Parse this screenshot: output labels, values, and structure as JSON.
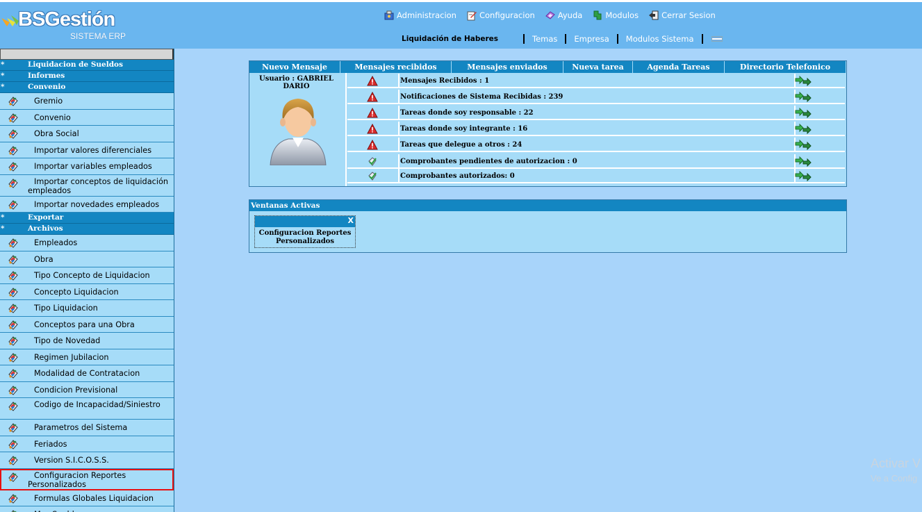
{
  "app": {
    "brand": "BSGestión",
    "subtitle": "SISTEMA ERP"
  },
  "topnav": [
    {
      "label": "Administracion",
      "icon": "admin-icon"
    },
    {
      "label": "Configuracion",
      "icon": "config-icon"
    },
    {
      "label": "Ayuda",
      "icon": "help-icon"
    },
    {
      "label": "Modulos",
      "icon": "modules-icon"
    },
    {
      "label": "Cerrar Sesion",
      "icon": "logout-icon"
    }
  ],
  "subnav": {
    "current": "Liquidación de Haberes",
    "links": [
      "Temas",
      "Empresa",
      "Modulos Sistema"
    ]
  },
  "sidebar": {
    "sections": [
      {
        "label": "Liquidacion de Sueldos",
        "items": []
      },
      {
        "label": "Informes",
        "items": []
      },
      {
        "label": "Convenio",
        "items": [
          "Gremio",
          "Convenio",
          "Obra Social",
          "Importar valores diferenciales",
          "Importar variables empleados",
          "Importar conceptos de liquidación empleados",
          "Importar novedades empleados"
        ]
      },
      {
        "label": "Exportar",
        "items": []
      },
      {
        "label": "Archivos",
        "items": [
          "Empleados",
          "Obra",
          "Tipo Concepto de Liquidacion",
          "Concepto Liquidacion",
          "Tipo Liquidacion",
          "Conceptos para una Obra",
          "Tipo de Novedad",
          "Regimen Jubilacion",
          "Modalidad de Contratacion",
          "Condicion Previsional",
          "Codigo de Incapacidad/Siniestro",
          "Parametros del Sistema",
          "Feriados",
          "Version S.I.C.O.S.S.",
          "Configuracion Reportes Personalizados",
          "Formulas Globales Liquidacion",
          "Mes Sueldo"
        ]
      }
    ],
    "highlighted": "Configuracion Reportes Personalizados"
  },
  "messages": {
    "tabs": [
      "Nuevo Mensaje",
      "Mensajes recibidos",
      "Mensajes enviados",
      "Nueva tarea",
      "Agenda Tareas",
      "Directorio Telefonico"
    ],
    "user_label": "Usuario : GABRIEL DARIO",
    "rows": [
      {
        "text": "Mensajes Recibidos : 1",
        "status": "warning"
      },
      {
        "text": "Notificaciones de Sistema Recibidas : 239",
        "status": "warning"
      },
      {
        "text": "Tareas donde soy responsable : 22",
        "status": "warning"
      },
      {
        "text": "Tareas donde soy integrante : 16",
        "status": "warning"
      },
      {
        "text": "Tareas que delegue a otros : 24",
        "status": "warning"
      },
      {
        "text": "Comprobantes pendientes de autorizacion : 0",
        "status": "ok"
      },
      {
        "text": "Comprobantes autorizados: 0",
        "status": "ok"
      }
    ]
  },
  "active_windows": {
    "title": "Ventanas Activas",
    "close_label": "X",
    "windows": [
      "Configuracion Reportes Personalizados"
    ]
  },
  "watermark": {
    "line1": "Activar V",
    "line2": "Ve a Config"
  },
  "colors": {
    "header": "#6ab6ef",
    "background": "#a8d4fa",
    "section": "#1386c2",
    "highlight_border": "#e81010"
  }
}
